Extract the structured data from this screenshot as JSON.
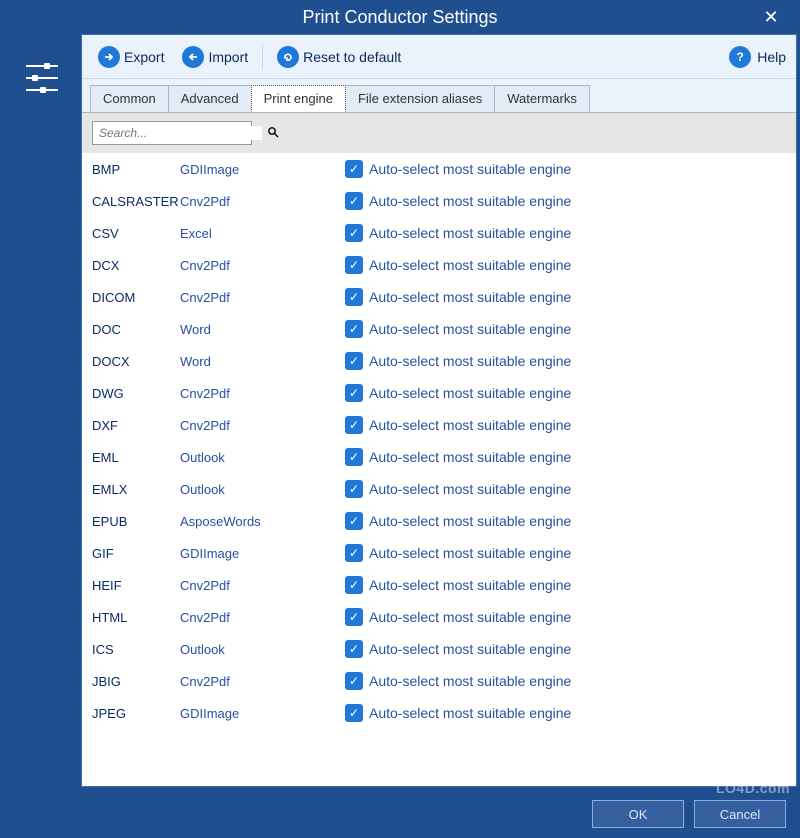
{
  "title": "Print Conductor Settings",
  "toolbar": {
    "export_label": "Export",
    "import_label": "Import",
    "reset_label": "Reset to default",
    "help_label": "Help"
  },
  "tabs": [
    "Common",
    "Advanced",
    "Print engine",
    "File extension aliases",
    "Watermarks"
  ],
  "active_tab": 2,
  "search": {
    "placeholder": "Search..."
  },
  "auto_label": "Auto-select most suitable engine",
  "rows": [
    {
      "format": "BMP",
      "engine": "GDIImage"
    },
    {
      "format": "CALSRASTER",
      "engine": "Cnv2Pdf"
    },
    {
      "format": "CSV",
      "engine": "Excel"
    },
    {
      "format": "DCX",
      "engine": "Cnv2Pdf"
    },
    {
      "format": "DICOM",
      "engine": "Cnv2Pdf"
    },
    {
      "format": "DOC",
      "engine": "Word"
    },
    {
      "format": "DOCX",
      "engine": "Word"
    },
    {
      "format": "DWG",
      "engine": "Cnv2Pdf"
    },
    {
      "format": "DXF",
      "engine": "Cnv2Pdf"
    },
    {
      "format": "EML",
      "engine": "Outlook"
    },
    {
      "format": "EMLX",
      "engine": "Outlook"
    },
    {
      "format": "EPUB",
      "engine": "AsposeWords"
    },
    {
      "format": "GIF",
      "engine": "GDIImage"
    },
    {
      "format": "HEIF",
      "engine": "Cnv2Pdf"
    },
    {
      "format": "HTML",
      "engine": "Cnv2Pdf"
    },
    {
      "format": "ICS",
      "engine": "Outlook"
    },
    {
      "format": "JBIG",
      "engine": "Cnv2Pdf"
    },
    {
      "format": "JPEG",
      "engine": "GDIImage"
    }
  ],
  "buttons": {
    "ok": "OK",
    "cancel": "Cancel"
  },
  "watermark": "LO4D.com"
}
